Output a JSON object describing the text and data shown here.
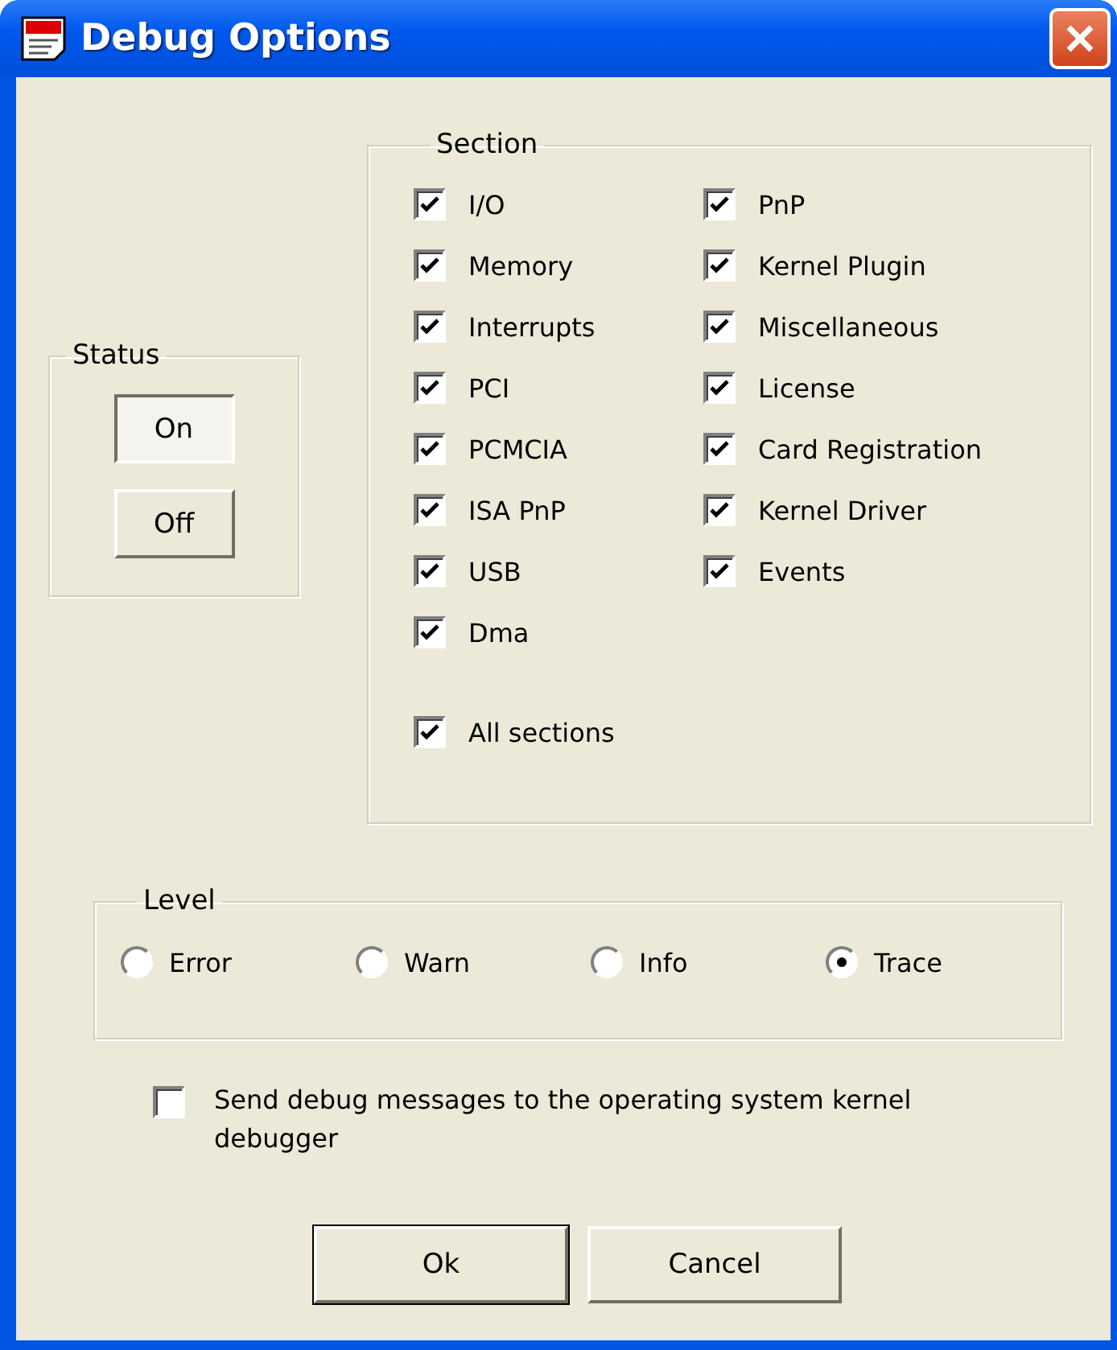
{
  "window": {
    "title": "Debug Options"
  },
  "status": {
    "label": "Status",
    "buttons": [
      {
        "label": "On",
        "selected": true
      },
      {
        "label": "Off",
        "selected": false
      }
    ]
  },
  "section": {
    "label": "Section",
    "columns": [
      {
        "items": [
          {
            "label": "I/O",
            "checked": true
          },
          {
            "label": "Memory",
            "checked": true
          },
          {
            "label": "Interrupts",
            "checked": true
          },
          {
            "label": "PCI",
            "checked": true
          },
          {
            "label": "PCMCIA",
            "checked": true
          },
          {
            "label": "ISA PnP",
            "checked": true
          },
          {
            "label": "USB",
            "checked": true
          },
          {
            "label": "Dma",
            "checked": true
          }
        ]
      },
      {
        "items": [
          {
            "label": "PnP",
            "checked": true
          },
          {
            "label": "Kernel Plugin",
            "checked": true
          },
          {
            "label": "Miscellaneous",
            "checked": true
          },
          {
            "label": "License",
            "checked": true
          },
          {
            "label": "Card Registration",
            "checked": true
          },
          {
            "label": "Kernel Driver",
            "checked": true
          },
          {
            "label": "Events",
            "checked": true
          }
        ]
      }
    ],
    "all_sections": {
      "label": "All sections",
      "checked": true
    }
  },
  "level": {
    "label": "Level",
    "options": [
      {
        "label": "Error",
        "selected": false
      },
      {
        "label": "Warn",
        "selected": false
      },
      {
        "label": "Info",
        "selected": false
      },
      {
        "label": "Trace",
        "selected": true
      }
    ]
  },
  "kernel_debugger": {
    "label": "Send debug messages to the operating system kernel debugger",
    "checked": false
  },
  "buttons": [
    {
      "label": "Ok"
    },
    {
      "label": "Cancel"
    }
  ]
}
